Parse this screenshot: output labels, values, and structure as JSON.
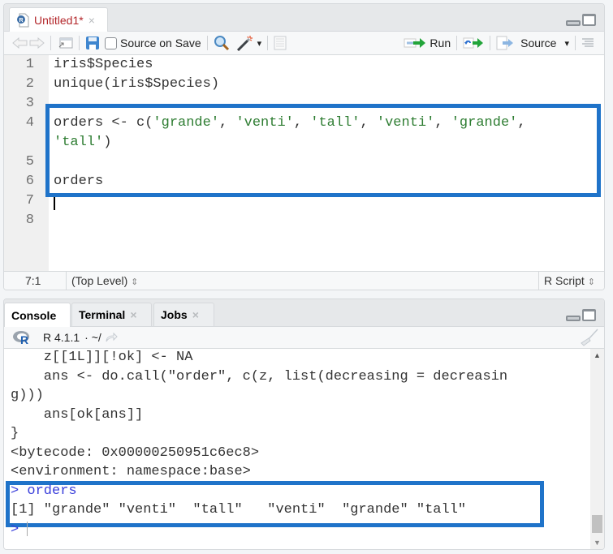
{
  "editor": {
    "tab": {
      "label": "Untitled1*",
      "close": "×",
      "icon": "r-file-icon"
    },
    "toolbar": {
      "source_on_save_label": "Source on Save",
      "source_on_save_checked": false,
      "run_label": "Run",
      "source_label": "Source",
      "source_dropdown": "▾",
      "wand_dropdown": "▾"
    },
    "lines": [
      {
        "num": "1",
        "parts": [
          {
            "t": "iris$Species",
            "c": "plain"
          }
        ]
      },
      {
        "num": "2",
        "parts": [
          {
            "t": "unique(iris$Species)",
            "c": "plain"
          }
        ]
      },
      {
        "num": "3",
        "parts": []
      },
      {
        "num": "4",
        "parts": [
          {
            "t": "orders <- c(",
            "c": "plain"
          },
          {
            "t": "'grande'",
            "c": "str"
          },
          {
            "t": ", ",
            "c": "plain"
          },
          {
            "t": "'venti'",
            "c": "str"
          },
          {
            "t": ", ",
            "c": "plain"
          },
          {
            "t": "'tall'",
            "c": "str"
          },
          {
            "t": ", ",
            "c": "plain"
          },
          {
            "t": "'venti'",
            "c": "str"
          },
          {
            "t": ", ",
            "c": "plain"
          },
          {
            "t": "'grande'",
            "c": "str"
          },
          {
            "t": ",",
            "c": "plain"
          }
        ]
      },
      {
        "num": "",
        "parts": [
          {
            "t": "'tall'",
            "c": "str"
          },
          {
            "t": ")",
            "c": "plain"
          }
        ]
      },
      {
        "num": "5",
        "parts": []
      },
      {
        "num": "6",
        "parts": [
          {
            "t": "orders",
            "c": "plain"
          }
        ]
      },
      {
        "num": "7",
        "parts": []
      },
      {
        "num": "8",
        "parts": []
      }
    ],
    "status": {
      "position": "7:1",
      "scope": "(Top Level)",
      "file_type": "R Script",
      "updown": "⇕"
    }
  },
  "console": {
    "tabs": [
      {
        "label": "Console",
        "active": true
      },
      {
        "label": "Terminal",
        "close": "×"
      },
      {
        "label": "Jobs",
        "close": "×"
      }
    ],
    "r_version": "R 4.1.1",
    "path": "· ~/",
    "lines": [
      {
        "text": "    z[[1L]][!ok] <- NA",
        "kind": "output"
      },
      {
        "text": "    ans <- do.call(\"order\", c(z, list(decreasing = decreasin",
        "kind": "output"
      },
      {
        "text": "g)))",
        "kind": "output"
      },
      {
        "text": "    ans[ok[ans]]",
        "kind": "output"
      },
      {
        "text": "}",
        "kind": "output"
      },
      {
        "text": "<bytecode: 0x00000250951c6ec8>",
        "kind": "output"
      },
      {
        "text": "<environment: namespace:base>",
        "kind": "output"
      },
      {
        "text": "orders",
        "kind": "input",
        "prompt": ">"
      },
      {
        "text": "[1] \"grande\" \"venti\"  \"tall\"   \"venti\"  \"grande\" \"tall\"",
        "kind": "output"
      },
      {
        "text": "",
        "kind": "input",
        "prompt": ">"
      }
    ]
  },
  "colors": {
    "highlight": "#1f73c9",
    "string": "#2e7d32",
    "prompt": "#3a3fdb",
    "tab_modified": "#b3262a"
  }
}
